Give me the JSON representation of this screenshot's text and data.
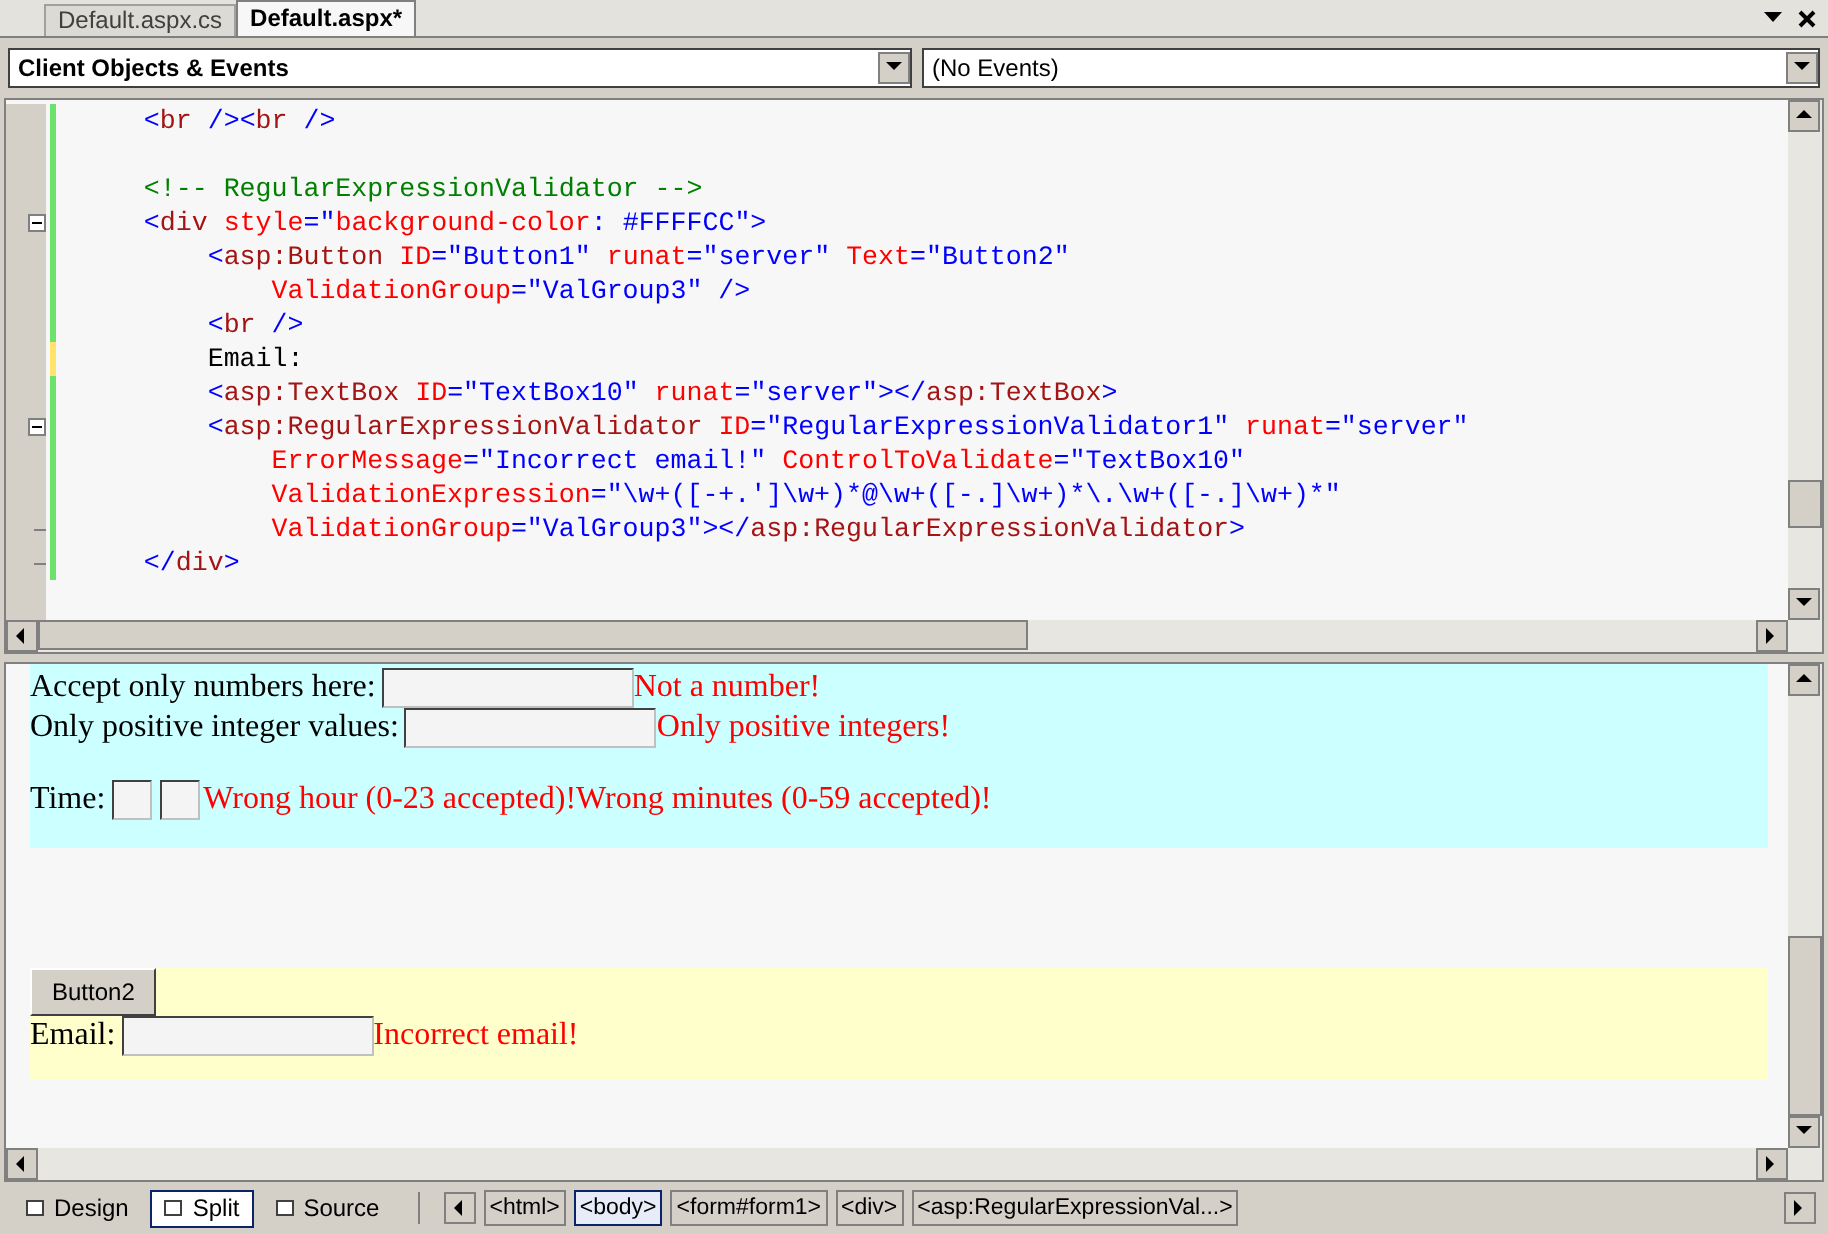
{
  "tabs": [
    {
      "label": "Default.aspx.cs",
      "selected": false
    },
    {
      "label": "Default.aspx*",
      "selected": true
    }
  ],
  "object_list": {
    "value": "Client Objects & Events"
  },
  "event_list": {
    "value": "(No Events)"
  },
  "code_lines": [
    {
      "modified": false,
      "collapsible": false,
      "block_end": false,
      "tokens": [
        {
          "kind": "punct",
          "text": "    <"
        },
        {
          "kind": "tag",
          "text": "br"
        },
        {
          "kind": "punct",
          "text": " /><"
        },
        {
          "kind": "tag",
          "text": "br"
        },
        {
          "kind": "punct",
          "text": " />"
        }
      ]
    },
    {
      "modified": false,
      "collapsible": false,
      "block_end": false
    },
    {
      "modified": false,
      "collapsible": false,
      "block_end": false,
      "tokens": [
        {
          "kind": "comment",
          "text": "    <!-- RegularExpressionValidator -->"
        }
      ]
    },
    {
      "modified": false,
      "collapsible": true,
      "block_end": false,
      "tokens": [
        {
          "kind": "punct",
          "text": "    <"
        },
        {
          "kind": "tag",
          "text": "div"
        },
        {
          "kind": "attr",
          "text": " style"
        },
        {
          "kind": "punct",
          "text": "=\""
        },
        {
          "kind": "attr",
          "text": "background-color"
        },
        {
          "kind": "punct",
          "text": ": #FFFFCC\">"
        }
      ]
    },
    {
      "modified": false,
      "collapsible": false,
      "block_end": false,
      "tokens": [
        {
          "kind": "punct",
          "text": "        <"
        },
        {
          "kind": "tag",
          "text": "asp:Button"
        },
        {
          "kind": "attr",
          "text": " ID"
        },
        {
          "kind": "punct",
          "text": "=\"Button1\""
        },
        {
          "kind": "attr",
          "text": " runat"
        },
        {
          "kind": "punct",
          "text": "=\"server\""
        },
        {
          "kind": "attr",
          "text": " Text"
        },
        {
          "kind": "punct",
          "text": "=\"Button2\""
        }
      ]
    },
    {
      "modified": false,
      "collapsible": false,
      "block_end": false,
      "tokens": [
        {
          "kind": "attr",
          "text": "            ValidationGroup"
        },
        {
          "kind": "punct",
          "text": "=\"ValGroup3\" />"
        }
      ]
    },
    {
      "modified": false,
      "collapsible": false,
      "block_end": false,
      "tokens": [
        {
          "kind": "punct",
          "text": "        <"
        },
        {
          "kind": "tag",
          "text": "br"
        },
        {
          "kind": "punct",
          "text": " />"
        }
      ]
    },
    {
      "modified": true,
      "collapsible": false,
      "block_end": false,
      "tokens": [
        {
          "kind": "text",
          "text": "        Email:"
        }
      ]
    },
    {
      "modified": false,
      "collapsible": false,
      "block_end": false,
      "tokens": [
        {
          "kind": "punct",
          "text": "        <"
        },
        {
          "kind": "tag",
          "text": "asp:TextBox"
        },
        {
          "kind": "attr",
          "text": " ID"
        },
        {
          "kind": "punct",
          "text": "=\"TextBox10\""
        },
        {
          "kind": "attr",
          "text": " runat"
        },
        {
          "kind": "punct",
          "text": "=\"server\"></"
        },
        {
          "kind": "tag",
          "text": "asp:TextBox"
        },
        {
          "kind": "punct",
          "text": ">"
        }
      ]
    },
    {
      "modified": false,
      "collapsible": true,
      "block_end": false,
      "tokens": [
        {
          "kind": "punct",
          "text": "        <"
        },
        {
          "kind": "tag",
          "text": "asp:RegularExpressionValidator"
        },
        {
          "kind": "attr",
          "text": " ID"
        },
        {
          "kind": "punct",
          "text": "=\"RegularExpressionValidator1\""
        },
        {
          "kind": "attr",
          "text": " runat"
        },
        {
          "kind": "punct",
          "text": "=\"server\""
        }
      ]
    },
    {
      "modified": false,
      "collapsible": false,
      "block_end": false,
      "tokens": [
        {
          "kind": "attr",
          "text": "            ErrorMessage"
        },
        {
          "kind": "punct",
          "text": "=\"Incorrect email!\""
        },
        {
          "kind": "attr",
          "text": " ControlToValidate"
        },
        {
          "kind": "punct",
          "text": "=\"TextBox10\""
        }
      ]
    },
    {
      "modified": false,
      "collapsible": false,
      "block_end": false,
      "tokens": [
        {
          "kind": "attr",
          "text": "            ValidationExpression"
        },
        {
          "kind": "punct",
          "text": "=\"\\w+([-+.']\\w+)*@\\w+([-.]\\w+)*\\.\\w+([-.]\\w+)*\""
        }
      ]
    },
    {
      "modified": false,
      "collapsible": false,
      "block_end": true,
      "tokens": [
        {
          "kind": "attr",
          "text": "            ValidationGroup"
        },
        {
          "kind": "punct",
          "text": "=\"ValGroup3\"></"
        },
        {
          "kind": "tag",
          "text": "asp:RegularExpressionValidator"
        },
        {
          "kind": "punct",
          "text": ">"
        }
      ]
    },
    {
      "modified": false,
      "collapsible": false,
      "block_end": true,
      "tokens": [
        {
          "kind": "punct",
          "text": "    </"
        },
        {
          "kind": "tag",
          "text": "div"
        },
        {
          "kind": "punct",
          "text": ">"
        }
      ]
    }
  ],
  "design": {
    "validator_block": [
      {
        "kind": "single",
        "label": "Accept only numbers here:",
        "error": "Not a number!"
      },
      {
        "kind": "single",
        "label": "Only positive integer values:",
        "error": "Only positive integers!"
      },
      {
        "kind": "time",
        "label": "Time:",
        "error": "Wrong hour (0-23 accepted)!Wrong minutes (0-59 accepted)!"
      }
    ],
    "button": "Button2",
    "email_label": "Email:",
    "email_error": "Incorrect email!"
  },
  "view_tabs": [
    {
      "label": "Design",
      "selected": false
    },
    {
      "label": "Split",
      "selected": true
    },
    {
      "label": "Source",
      "selected": false
    }
  ],
  "breadcrumbs": [
    {
      "label": "<html>",
      "selected": false
    },
    {
      "label": "<body>",
      "selected": true
    },
    {
      "label": "<form#form1>",
      "selected": false
    },
    {
      "label": "<div>",
      "selected": false
    },
    {
      "label": "<asp:RegularExpressionVal...>",
      "selected": false
    }
  ]
}
